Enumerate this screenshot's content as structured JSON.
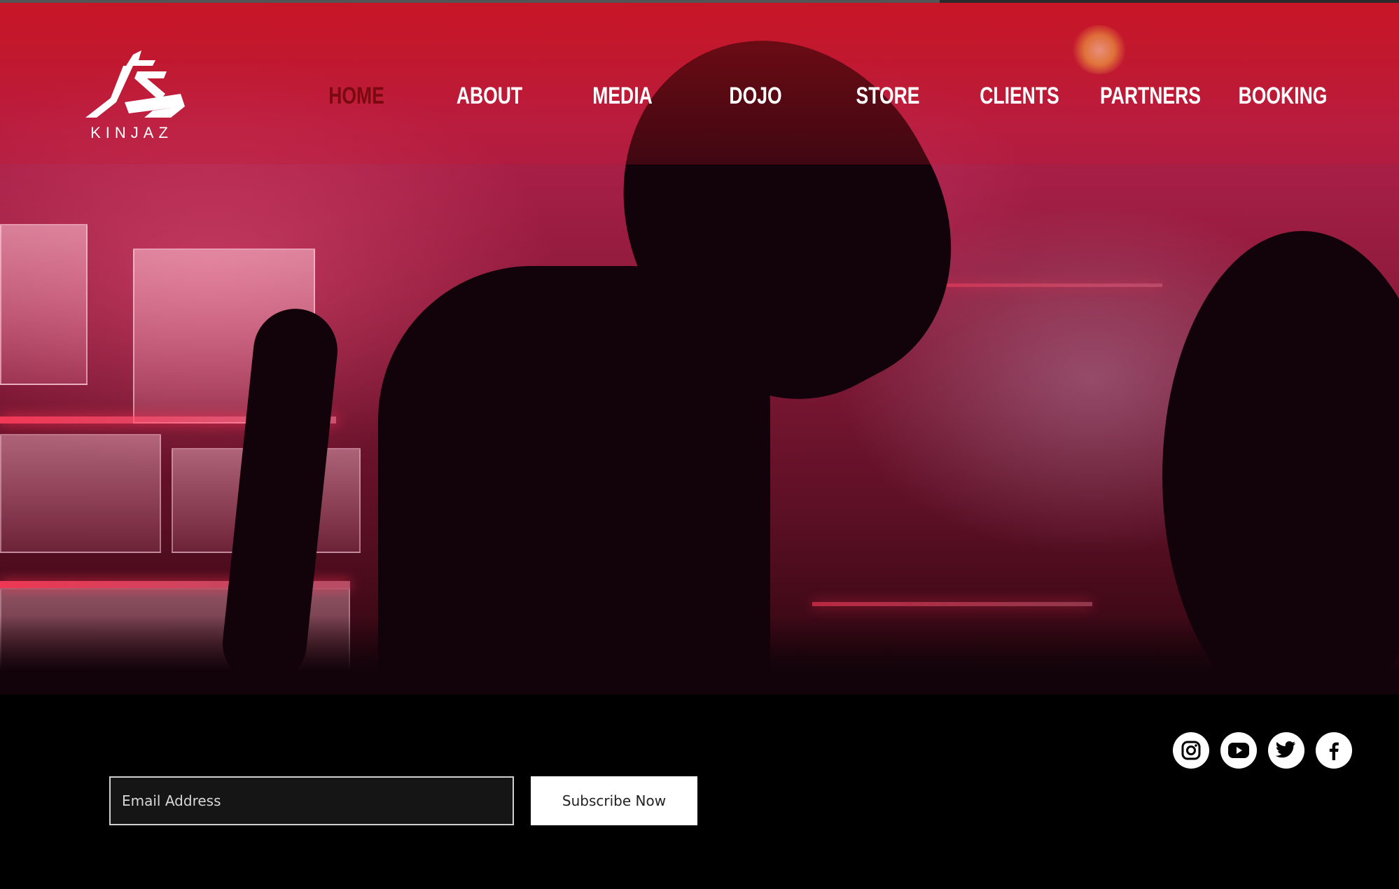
{
  "brand": {
    "logo_text": "KINJAZ"
  },
  "nav": {
    "items": [
      {
        "label": "HOME",
        "active": true
      },
      {
        "label": "ABOUT",
        "active": false
      },
      {
        "label": "MEDIA",
        "active": false
      },
      {
        "label": "DOJO",
        "active": false
      },
      {
        "label": "STORE",
        "active": false
      },
      {
        "label": "CLIENTS",
        "active": false
      },
      {
        "label": "PARTNERS",
        "active": false
      },
      {
        "label": "BOOKING",
        "active": false
      }
    ]
  },
  "subscribe": {
    "email_placeholder": "Email Address",
    "email_value": "",
    "button_label": "Subscribe Now"
  },
  "social": [
    "instagram-icon",
    "youtube-icon",
    "twitter-icon",
    "facebook-icon"
  ],
  "colors": {
    "accent": "#c8102e",
    "active_nav": "#7a0a10",
    "footer_bg": "#000000"
  }
}
